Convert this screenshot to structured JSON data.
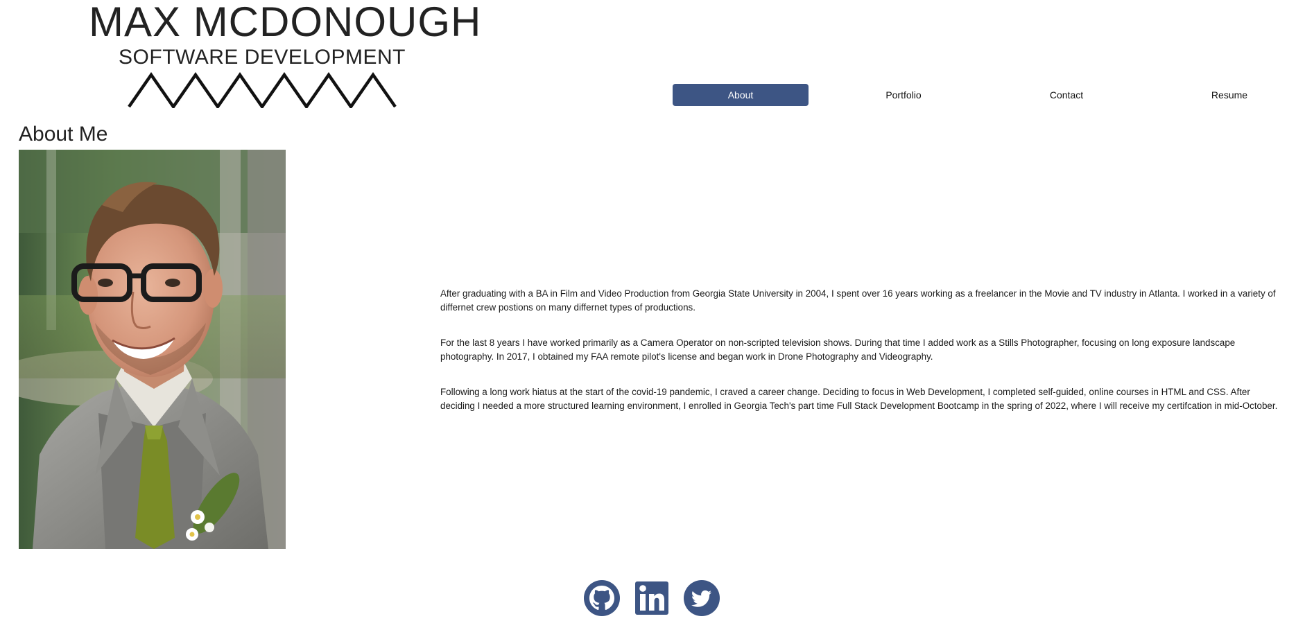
{
  "header": {
    "name": "MAX MCDONOUGH",
    "tagline": "SOFTWARE DEVELOPMENT",
    "logo_color": "#222222"
  },
  "nav": {
    "items": [
      {
        "label": "About",
        "active": true
      },
      {
        "label": "Portfolio",
        "active": false
      },
      {
        "label": "Contact",
        "active": false
      },
      {
        "label": "Resume",
        "active": false
      }
    ],
    "active_color": "#3d5584"
  },
  "about": {
    "title": "About Me",
    "paragraphs": [
      "After graduating with a BA in Film and Video Production from Georgia State University in 2004, I spent over 16 years working as a freelancer in the Movie and TV industry in Atlanta. I worked in a variety of differnet crew postions on many differnet types of productions.",
      "For the last 8 years I have worked primarily as a Camera Operator on non-scripted television shows. During that time I added work as a Stills Photographer, focusing on long exposure landscape photography. In 2017, I obtained my FAA remote pilot's license and began work in Drone Photography and Videography.",
      "Following a long work hiatus at the start of the covid-19 pandemic, I craved a career change. Deciding to focus in Web Development, I completed self-guided, online courses in HTML and CSS. After deciding I needed a more structured learning environment, I enrolled in Georgia Tech's part time Full Stack Development Bootcamp in the spring of 2022, where I will receive my certifcation in mid-October."
    ]
  },
  "social": {
    "links": [
      {
        "icon": "github-icon"
      },
      {
        "icon": "linkedin-icon"
      },
      {
        "icon": "twitter-icon"
      }
    ],
    "color": "#3d5584"
  }
}
